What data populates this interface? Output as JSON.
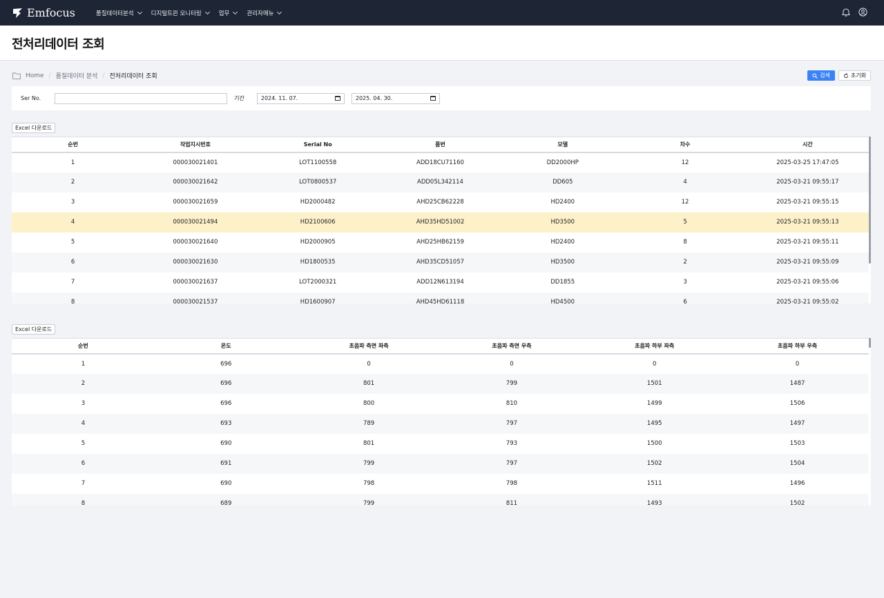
{
  "app": {
    "brand": "Emfocus"
  },
  "nav": [
    {
      "label": "품질데이터분석"
    },
    {
      "label": "디지털트윈 모니터링"
    },
    {
      "label": "업무"
    },
    {
      "label": "관리자메뉴"
    }
  ],
  "header": {
    "bell_icon": "bell-icon",
    "user_icon": "user-circle-icon"
  },
  "page": {
    "title": "전처리데이터 조회"
  },
  "breadcrumb": {
    "home": "Home",
    "section": "품질데이터 분석",
    "current": "전처리데이터 조회"
  },
  "toolbar": {
    "search_label": "검색",
    "reset_label": "초기화"
  },
  "filter": {
    "serno_label": "Ser No.",
    "serno_value": "",
    "period_label": "기간",
    "date_from": "2024. 11. 07.",
    "date_to": "2025. 04. 30."
  },
  "colors": {
    "accent": "#3b82f6",
    "topbar": "#1e2535",
    "selected_row": "#fcf1c9"
  },
  "table1": {
    "excel_label": "Excel 다운로드",
    "columns": [
      "순번",
      "작업지시번호",
      "Serial No",
      "품번",
      "모델",
      "차수",
      "시간"
    ],
    "rows": [
      [
        "1",
        "000030021401",
        "LOT1100558",
        "ADD18CU71160",
        "DD2000HP",
        "12",
        "2025-03-25 17:47:05"
      ],
      [
        "2",
        "000030021642",
        "LOT0800537",
        "ADD05L342114",
        "DD605",
        "4",
        "2025-03-21 09:55:17"
      ],
      [
        "3",
        "000030021659",
        "HD2000482",
        "AHD25CB62228",
        "HD2400",
        "12",
        "2025-03-21 09:55:15"
      ],
      [
        "4",
        "000030021494",
        "HD2100606",
        "AHD35HD51002",
        "HD3500",
        "5",
        "2025-03-21 09:55:13"
      ],
      [
        "5",
        "000030021640",
        "HD2000905",
        "AHD25HB62159",
        "HD2400",
        "8",
        "2025-03-21 09:55:11"
      ],
      [
        "6",
        "000030021630",
        "HD1800535",
        "AHD35CD51057",
        "HD3500",
        "2",
        "2025-03-21 09:55:09"
      ],
      [
        "7",
        "000030021637",
        "LOT2000321",
        "ADD12N613194",
        "DD1855",
        "3",
        "2025-03-21 09:55:06"
      ],
      [
        "8",
        "000030021537",
        "HD1600907",
        "AHD45HD61118",
        "HD4500",
        "6",
        "2025-03-21 09:55:02"
      ]
    ],
    "selected_index": 3
  },
  "table2": {
    "excel_label": "Excel 다운로드",
    "columns": [
      "순번",
      "온도",
      "초음파 측면 좌측",
      "초음파 측면 우측",
      "초음파 하부 좌측",
      "초음파 하부 우측"
    ],
    "rows": [
      [
        "1",
        "696",
        "0",
        "0",
        "0",
        "0"
      ],
      [
        "2",
        "696",
        "801",
        "799",
        "1501",
        "1487"
      ],
      [
        "3",
        "696",
        "800",
        "810",
        "1499",
        "1506"
      ],
      [
        "4",
        "693",
        "789",
        "797",
        "1495",
        "1497"
      ],
      [
        "5",
        "690",
        "801",
        "793",
        "1500",
        "1503"
      ],
      [
        "6",
        "691",
        "799",
        "797",
        "1502",
        "1504"
      ],
      [
        "7",
        "690",
        "798",
        "798",
        "1511",
        "1496"
      ],
      [
        "8",
        "689",
        "799",
        "811",
        "1493",
        "1502"
      ]
    ]
  }
}
